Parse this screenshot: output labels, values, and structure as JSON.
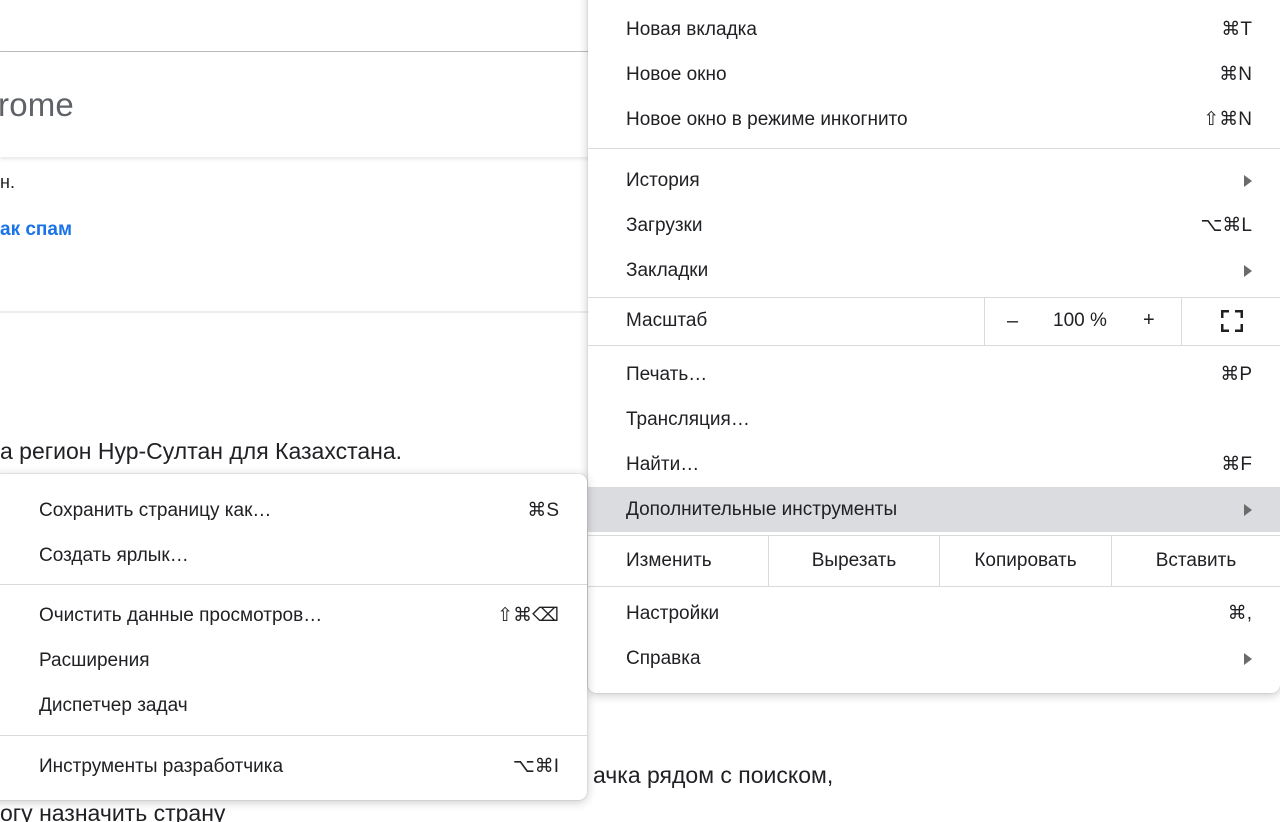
{
  "background": {
    "header_title": "rome",
    "text_line": "н.",
    "spam_link": "ак спам",
    "paragraph_1": "а регион Нур-Султан для Казахстана.",
    "paragraph_2": "ачка рядом с поиском,",
    "paragraph_3": "огу назначить страну",
    "link_color": "#1a73e8"
  },
  "main_menu": {
    "new_tab": {
      "label": "Новая вкладка",
      "shortcut": "⌘T"
    },
    "new_window": {
      "label": "Новое окно",
      "shortcut": "⌘N"
    },
    "incognito": {
      "label": "Новое окно в режиме инкогнито",
      "shortcut": "⇧⌘N"
    },
    "history": {
      "label": "История",
      "icon": "chevron-right-icon"
    },
    "downloads": {
      "label": "Загрузки",
      "shortcut": "⌥⌘L"
    },
    "bookmarks": {
      "label": "Закладки",
      "icon": "chevron-right-icon"
    },
    "zoom": {
      "label": "Масштаб",
      "minus": "–",
      "value": "100 %",
      "plus": "+",
      "fullscreen_icon": "fullscreen-icon"
    },
    "print": {
      "label": "Печать…",
      "shortcut": "⌘P"
    },
    "cast": {
      "label": "Трансляция…"
    },
    "find": {
      "label": "Найти…",
      "shortcut": "⌘F"
    },
    "more_tools": {
      "label": "Дополнительные инструменты",
      "icon": "chevron-right-icon"
    },
    "edit": {
      "label": "Изменить",
      "cut": "Вырезать",
      "copy": "Копировать",
      "paste": "Вставить"
    },
    "settings": {
      "label": "Настройки",
      "shortcut": "⌘,"
    },
    "help": {
      "label": "Справка",
      "icon": "chevron-right-icon"
    },
    "highlight_color": "#dadce0"
  },
  "sub_menu": {
    "save_page": {
      "label": "Сохранить страницу как…",
      "shortcut": "⌘S"
    },
    "create_shortcut": {
      "label": "Создать ярлык…"
    },
    "clear_data": {
      "label": "Очистить данные просмотров…",
      "shortcut": "⇧⌘⌫"
    },
    "extensions": {
      "label": "Расширения"
    },
    "task_manager": {
      "label": "Диспетчер задач"
    },
    "dev_tools": {
      "label": "Инструменты разработчика",
      "shortcut": "⌥⌘I"
    }
  }
}
